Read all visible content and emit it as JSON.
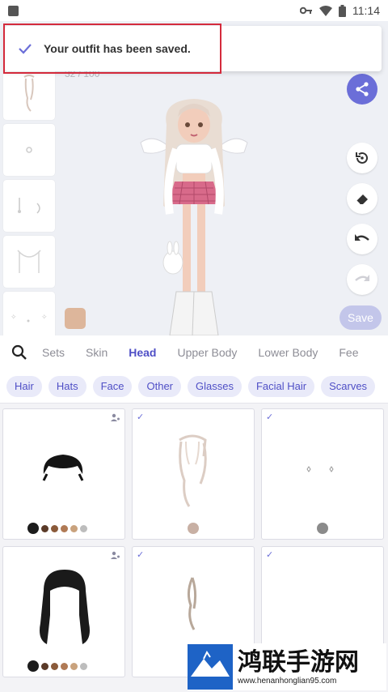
{
  "status_bar": {
    "time": "11:14"
  },
  "toast": {
    "message": "Your outfit has been saved."
  },
  "editor": {
    "counter": "32 / 100",
    "skin_color": "#ddb69b",
    "save_label": "Save"
  },
  "category_tabs": [
    {
      "label": "Sets",
      "active": false
    },
    {
      "label": "Skin",
      "active": false
    },
    {
      "label": "Head",
      "active": true
    },
    {
      "label": "Upper Body",
      "active": false
    },
    {
      "label": "Lower Body",
      "active": false
    },
    {
      "label": "Fee",
      "active": false
    }
  ],
  "chips": [
    "Hair",
    "Hats",
    "Face",
    "Other",
    "Glasses",
    "Facial Hair",
    "Scarves"
  ],
  "grid_items": [
    {
      "kind": "hair-short-black",
      "selected": false,
      "palette": [
        "#1c1c1c",
        "#5a3a28",
        "#8a5a3a",
        "#b07a55",
        "#c9a27d",
        "#bdbdbd"
      ]
    },
    {
      "kind": "hair-long-blonde",
      "selected": true,
      "palette": [
        "#c8b0a4"
      ]
    },
    {
      "kind": "face-sparkles",
      "selected": true,
      "palette": [
        "#8b8b8b"
      ]
    },
    {
      "kind": "hair-long-black",
      "selected": false,
      "palette": [
        "#1c1c1c",
        "#5a3a28",
        "#8a5a3a",
        "#b07a55",
        "#c9a27d",
        "#bdbdbd"
      ]
    },
    {
      "kind": "hair-wisp",
      "selected": true,
      "palette": []
    },
    {
      "kind": "empty",
      "selected": true,
      "palette": []
    }
  ],
  "watermark": {
    "title": "鸿联手游网",
    "url": "www.henanhonglian95.com"
  },
  "colors": {
    "accent": "#6b6ed8",
    "active_tab": "#4f4fc6",
    "highlight": "#d42a3c"
  }
}
